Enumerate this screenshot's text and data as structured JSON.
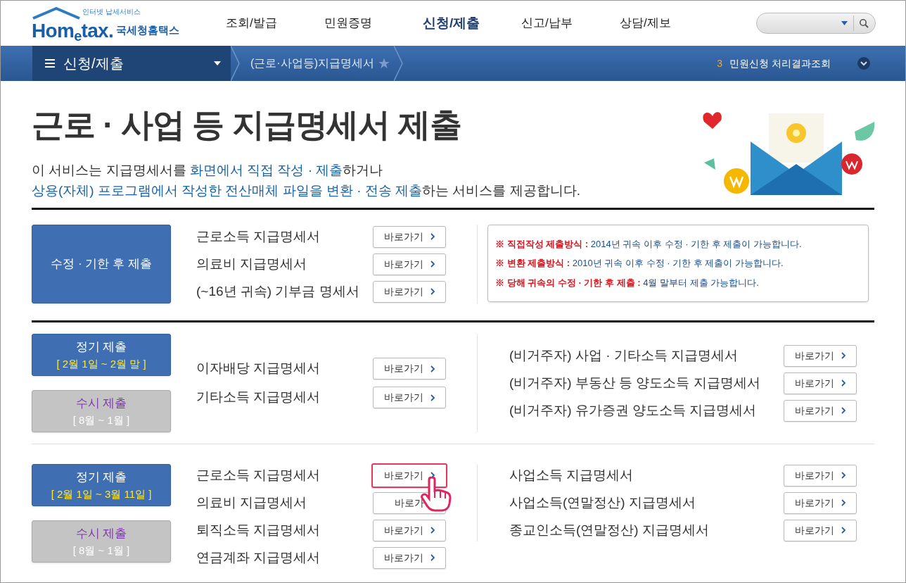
{
  "header": {
    "logo": {
      "tagline": "인터넷 납세서비스",
      "brand": "Hom$_{e}$tax.",
      "name": "국세청홈택스"
    },
    "nav": [
      {
        "label": "조회/발급",
        "selected": false
      },
      {
        "label": "민원증명",
        "selected": false
      },
      {
        "label": "신청/제출",
        "selected": true
      },
      {
        "label": "신고/납부",
        "selected": false
      },
      {
        "label": "상담/제보",
        "selected": false
      }
    ]
  },
  "subbar": {
    "menu": "신청/제출",
    "breadcrumb": "(근로·사업등)지급명세서",
    "count": "3",
    "notice": "민원신청 처리결과조회"
  },
  "title": "근로 · 사업 등 지급명세서 제출",
  "description": [
    "이 서비스는 지급명세서를 **화면에서 직접 작성 · 제출**하거나",
    "**상용(자체) 프로그램에서 작성한 전산매체 파일을 변환 · 전송 제출**하는 서비스를 제공합니다."
  ],
  "sections": [
    {
      "tags": [
        {
          "title": "수정 · 기한 후 제출",
          "selected": true
        }
      ],
      "left": [
        {
          "label": "근로소득 지급명세서",
          "button": "바로가기",
          "highlighted": false
        },
        {
          "label": "의료비 지급명세서",
          "button": "바로가기",
          "highlighted": false
        },
        {
          "label": "(~16년 귀속) 기부금 명세서",
          "button": "바로가기",
          "highlighted": false
        }
      ],
      "notes": [
        {
          "label": "※ 직접작성 제출방식 :",
          "text": "2014년 귀속 이후 수정 · 기한 후 제출이 가능합니다."
        },
        {
          "label": "※ 변환 제출방식 :",
          "text": "2010년 귀속 이후 수정 · 기한 후 제출이 가능합니다."
        },
        {
          "label": "※ 당해 귀속의 수정 · 기한 후 제출 :",
          "text": "4월 말부터 제출 가능합니다."
        }
      ]
    },
    {
      "tags": [
        {
          "title": "정기 제출",
          "period": "[ 2월 1일 ~ 2월 말 ]",
          "selected": true
        },
        {
          "title": "수시 제출",
          "period": "[ 8월 ~ 1월 ]",
          "selected": false
        }
      ],
      "left": [
        {
          "label": "이자배당 지급명세서",
          "button": "바로가기",
          "highlighted": false
        },
        {
          "label": "기타소득 지급명세서",
          "button": "바로가기",
          "highlighted": false
        }
      ],
      "right": [
        {
          "label": "(비거주자) 사업 · 기타소득 지급명세서",
          "button": "바로가기",
          "highlighted": false
        },
        {
          "label": "(비거주자) 부동산 등 양도소득 지급명세서",
          "button": "바로가기",
          "highlighted": false
        },
        {
          "label": "(비거주자) 유가증권 양도소득 지급명세서",
          "button": "바로가기",
          "highlighted": false
        }
      ]
    },
    {
      "tags": [
        {
          "title": "정기 제출",
          "period": "[ 2월 1일 ~ 3월 11일 ]",
          "selected": true
        },
        {
          "title": "수시 제출",
          "period": "[ 8월 ~ 1월 ]",
          "selected": false
        }
      ],
      "left": [
        {
          "label": "근로소득 지급명세서",
          "button": "바로가기",
          "highlighted": true
        },
        {
          "label": "의료비 지급명세서",
          "button": "바로가",
          "highlighted": false,
          "cursor": true
        },
        {
          "label": "퇴직소득 지급명세서",
          "button": "바로가기",
          "highlighted": false
        },
        {
          "label": "연금계좌 지급명세서",
          "button": "바로가기",
          "highlighted": false
        }
      ],
      "right": [
        {
          "label": "사업소득 지급명세서",
          "button": "바로가기",
          "highlighted": false
        },
        {
          "label": "사업소득(연말정산) 지급명세서",
          "button": "바로가기",
          "highlighted": false
        },
        {
          "label": "종교인소득(연말정산) 지급명세서",
          "button": "바로가기",
          "highlighted": false
        }
      ]
    }
  ]
}
